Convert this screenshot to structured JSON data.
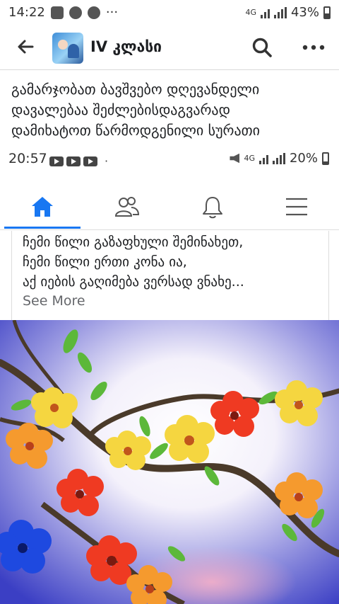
{
  "status_bar": {
    "time": "14:22",
    "dots": "···",
    "network": "4G",
    "battery": "43%"
  },
  "app_bar": {
    "group_name": "IV კლასი"
  },
  "post": {
    "lines": [
      "გამარჯობათ ბავშვებო დღევანდელი",
      "დავალებაა შეძლებისდაგვარად",
      "დამიხატოთ წარმოდგენილი სურათი"
    ]
  },
  "inner_status_bar": {
    "time": "20:57",
    "dot": "·",
    "network": "4G",
    "battery": "20%"
  },
  "shared_post": {
    "lines": [
      "ჩემი წილი გაზაფხული შემინახეთ,",
      "ჩემი წილი ერთი კონა ია,",
      "აქ იების გაღიმება ვერსად ვნახე..."
    ],
    "see_more": "See More"
  },
  "colors": {
    "accent": "#1877f2",
    "text": "#1c1e21",
    "muted": "#65676b"
  },
  "icons": [
    "back-arrow-icon",
    "search-icon",
    "more-icon",
    "home-icon",
    "friends-icon",
    "bell-icon",
    "menu-icon"
  ]
}
